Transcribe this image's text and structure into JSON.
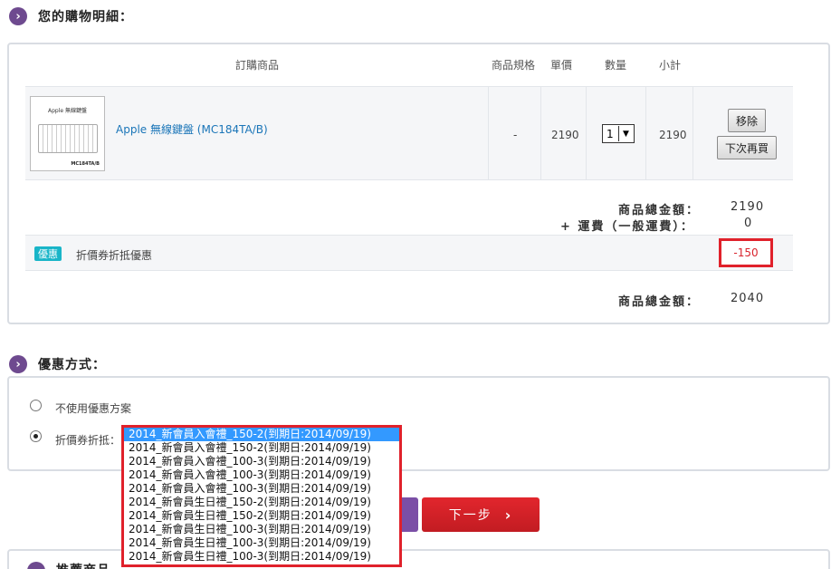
{
  "cart": {
    "section_title": "您的購物明細：",
    "headers": {
      "product": "訂購商品",
      "spec": "商品規格",
      "price": "單價",
      "qty": "數量",
      "subtotal": "小計"
    },
    "item": {
      "thumb_title": "Apple 無線鍵盤",
      "thumb_model": "MC184TA/B",
      "name": "Apple 無線鍵盤 (MC184TA/B)",
      "spec": "-",
      "price": "2190",
      "qty": "1",
      "subtotal": "2190",
      "remove_label": "移除",
      "later_label": "下次再買"
    },
    "summary": {
      "goods_total_label": "商品總金額：",
      "goods_total_value": "2190",
      "shipping_label": "+ 運費（一般運費）：",
      "shipping_value": "0",
      "discount_badge": "優惠",
      "discount_text": "折價券折抵優惠",
      "discount_value": "-150",
      "final_label": "商品總金額：",
      "final_value": "2040"
    }
  },
  "promo": {
    "section_title": "優惠方式：",
    "option_none": "不使用優惠方案",
    "option_coupon": "折價券折抵：",
    "coupons": [
      "2014_新會員入會禮_150-2(到期日:2014/09/19)",
      "2014_新會員入會禮_150-2(到期日:2014/09/19)",
      "2014_新會員入會禮_100-3(到期日:2014/09/19)",
      "2014_新會員入會禮_100-3(到期日:2014/09/19)",
      "2014_新會員入會禮_100-3(到期日:2014/09/19)",
      "2014_新會員生日禮_150-2(到期日:2014/09/19)",
      "2014_新會員生日禮_150-2(到期日:2014/09/19)",
      "2014_新會員生日禮_100-3(到期日:2014/09/19)",
      "2014_新會員生日禮_100-3(到期日:2014/09/19)",
      "2014_新會員生日禮_100-3(到期日:2014/09/19)"
    ],
    "selected_index": 0
  },
  "nav": {
    "next_label": "下一步",
    "chevron_glyph": "›"
  },
  "recommend": {
    "section_title": "推薦商品"
  },
  "colors": {
    "accent_purple": "#6e4a8f",
    "next_red": "#d9232d",
    "highlight_red": "#e0212b",
    "badge_teal": "#19b5c8",
    "link_blue": "#1a75b8"
  }
}
